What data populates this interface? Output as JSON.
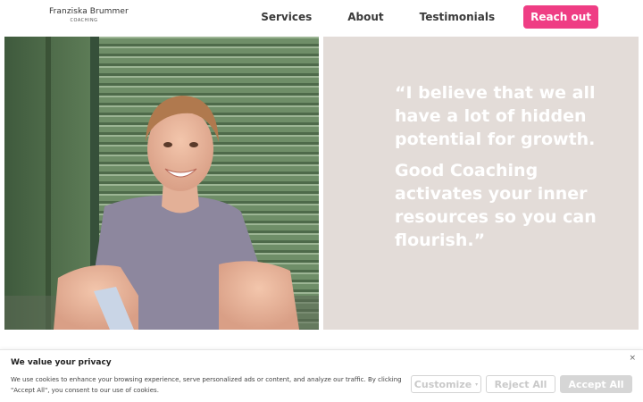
{
  "header": {
    "logo_name": "Franziska Brummer",
    "logo_sub": "COACHING",
    "nav": [
      "Services",
      "About",
      "Testimonials"
    ],
    "cta_label": "Reach out"
  },
  "hero": {
    "photo_alt": "Smiling woman sitting in front of a green shutter",
    "quote_line1": "“I believe that we all have a lot of hidden potential for growth.",
    "quote_line2": "Good Coaching activates your inner resources so you can flourish.”"
  },
  "cookie": {
    "title": "We value your privacy",
    "text": "We use cookies to enhance your browsing experience, serve personalized ads or content, and analyze our traffic. By clicking \"Accept All\", you consent to our use of cookies.",
    "close": "×",
    "customize_label": "Customize",
    "reject_label": "Reject All",
    "accept_label": "Accept All"
  },
  "colors": {
    "accent": "#ef3d84",
    "quote_panel": "#e3dcd8",
    "shutter_green": "#6d8c66"
  },
  "icons": {
    "close": "close-icon",
    "caret": "chevron-down-icon"
  }
}
